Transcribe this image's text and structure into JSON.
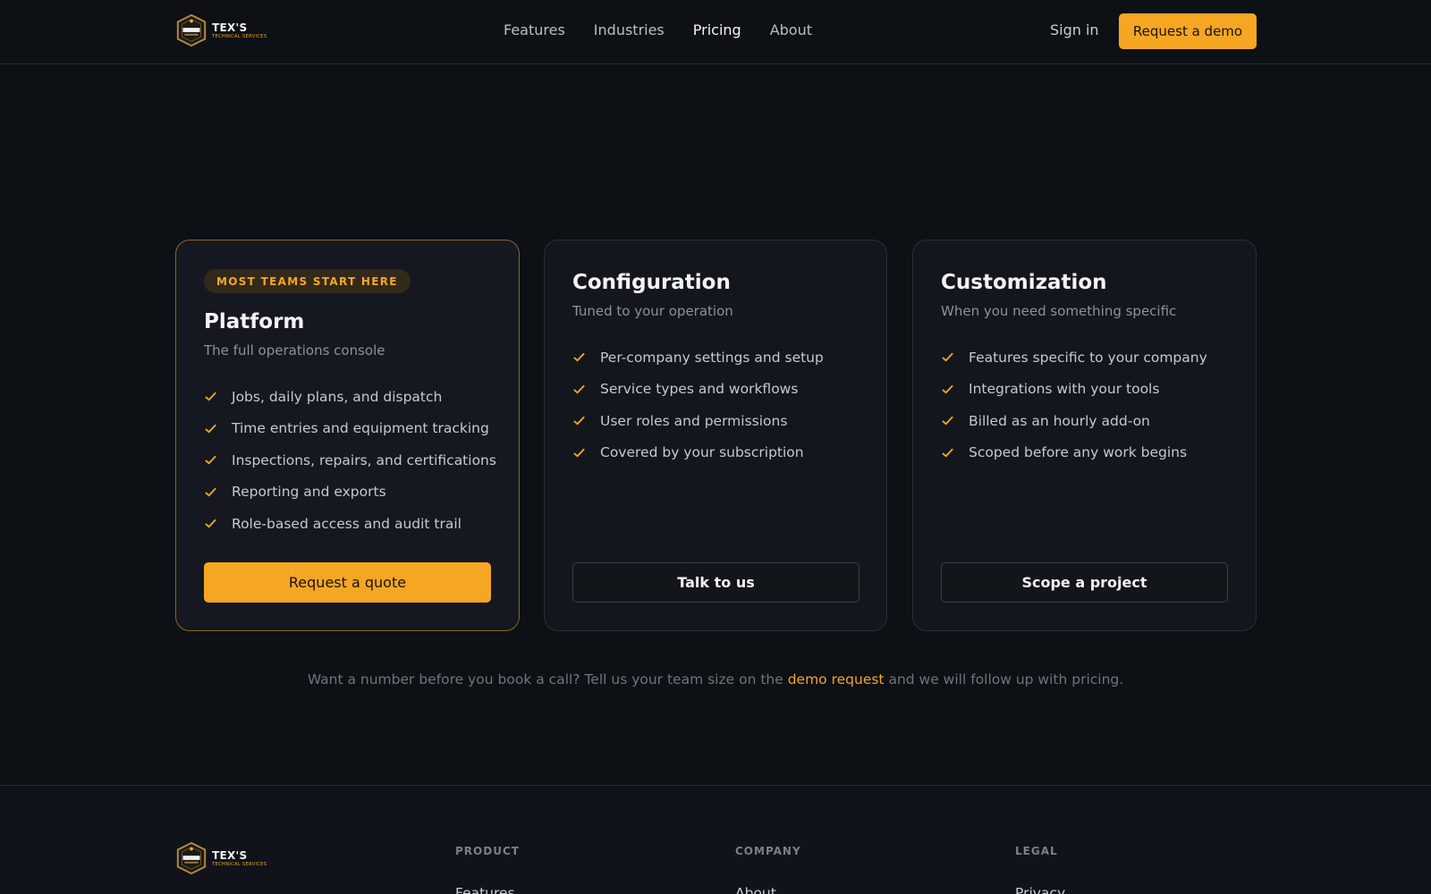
{
  "brand": {
    "name": "TEX'S",
    "tagline": "TECHNICAL SERVICES"
  },
  "nav": {
    "items": [
      "Features",
      "Industries",
      "Pricing",
      "About"
    ],
    "active": "Pricing",
    "signin": "Sign in",
    "demo": "Request a demo"
  },
  "colors": {
    "accent": "#f5a623",
    "background": "#0d1015",
    "card": "#13161c"
  },
  "plans": [
    {
      "badge": "MOST TEAMS START HERE",
      "title": "Platform",
      "subtitle": "The full operations console",
      "features": [
        "Jobs, daily plans, and dispatch",
        "Time entries and equipment tracking",
        "Inspections, repairs, and certifications",
        "Reporting and exports",
        "Role-based access and audit trail"
      ],
      "cta": "Request a quote"
    },
    {
      "title": "Configuration",
      "subtitle": "Tuned to your operation",
      "features": [
        "Per-company settings and setup",
        "Service types and workflows",
        "User roles and permissions",
        "Covered by your subscription"
      ],
      "cta": "Talk to us"
    },
    {
      "title": "Customization",
      "subtitle": "When you need something specific",
      "features": [
        "Features specific to your company",
        "Integrations with your tools",
        "Billed as an hourly add-on",
        "Scoped before any work begins"
      ],
      "cta": "Scope a project"
    }
  ],
  "note": {
    "before": "Want a number before you book a call? Tell us your team size on the ",
    "link": "demo request",
    "after": " and we will follow up with pricing."
  },
  "footer": {
    "columns": [
      {
        "heading": "PRODUCT",
        "link": "Features"
      },
      {
        "heading": "COMPANY",
        "link": "About"
      },
      {
        "heading": "LEGAL",
        "link": "Privacy"
      }
    ]
  }
}
